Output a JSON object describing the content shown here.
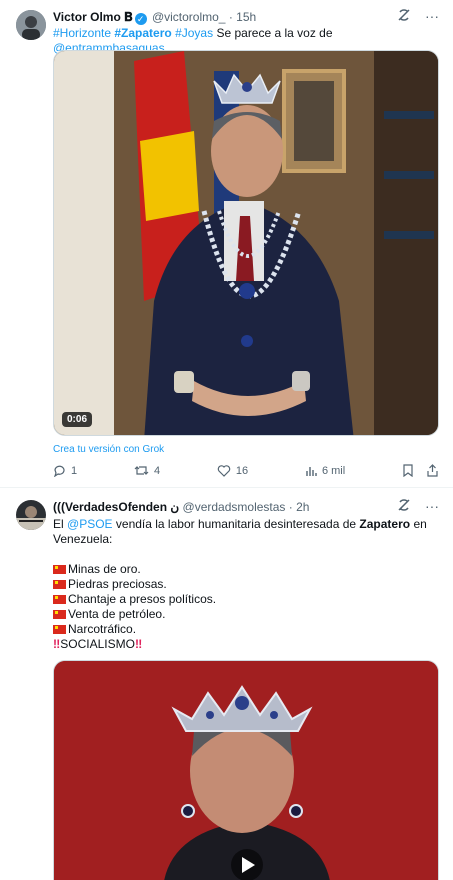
{
  "tweet1": {
    "display_name": "Victor Olmo",
    "name_badge": "𝐁",
    "handle": "@victorolmo_",
    "time": "· 15h",
    "hashtags": [
      "#Horizonte",
      "#Zapatero",
      "#Joyas"
    ],
    "text_rest": "Se parece a la voz de",
    "mention": "@entrammbasaguas",
    "video_duration": "0:06",
    "grok_label": "Crea tu versión con Grok",
    "actions": {
      "replies": "1",
      "retweets": "4",
      "likes": "16",
      "views": "6 mil"
    }
  },
  "tweet2": {
    "display_name": "(((VerdadesOfenden",
    "name_suffix": "ﻥ",
    "handle": "@verdadsmolestas",
    "time": "· 2h",
    "intro_1": "El",
    "mention": "@PSOE",
    "intro_2": "vendía la labor humanitaria desinteresada de",
    "intro_bold": "Zapatero",
    "intro_3": "en Venezuela:",
    "items": [
      "Minas de oro.",
      "Piedras preciosas.",
      "Chantaje a presos políticos.",
      "Venta de petróleo.",
      "Narcotráfico."
    ],
    "closing": "SOCIALISMO"
  },
  "colors": {
    "accent": "#1d9bf0",
    "muted": "#536471",
    "flag_red": "#da291c",
    "alert_red": "#e0245e"
  },
  "icons": [
    "grok-icon",
    "more-icon",
    "verified-icon",
    "reply-icon",
    "retweet-icon",
    "like-icon",
    "views-icon",
    "bookmark-icon",
    "share-icon",
    "play-icon"
  ]
}
